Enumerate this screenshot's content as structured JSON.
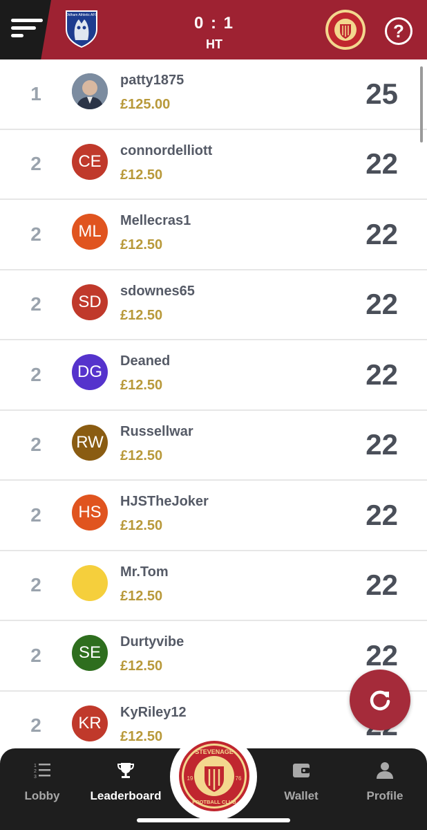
{
  "header": {
    "menu_icon": "menu-icon",
    "home_team_crest": "oldham-athletic-crest",
    "home_crest_text": "Oldham Athletic AFC",
    "score": "0 : 1",
    "period": "HT",
    "away_team_crest": "stevenage-crest",
    "help_label": "?"
  },
  "leaderboard": [
    {
      "rank": "1",
      "initials": "",
      "avatar_color": "#6b7a8a",
      "username": "patty1875",
      "prize": "£125.00",
      "points": "25"
    },
    {
      "rank": "2",
      "initials": "CE",
      "avatar_color": "#c0392b",
      "username": "connordelliott",
      "prize": "£12.50",
      "points": "22"
    },
    {
      "rank": "2",
      "initials": "ML",
      "avatar_color": "#e0541f",
      "username": "Mellecras1",
      "prize": "£12.50",
      "points": "22"
    },
    {
      "rank": "2",
      "initials": "SD",
      "avatar_color": "#c0392b",
      "username": "sdownes65",
      "prize": "£12.50",
      "points": "22"
    },
    {
      "rank": "2",
      "initials": "DG",
      "avatar_color": "#5533cc",
      "username": "Deaned",
      "prize": "£12.50",
      "points": "22"
    },
    {
      "rank": "2",
      "initials": "RW",
      "avatar_color": "#8a5c12",
      "username": "Russellwar",
      "prize": "£12.50",
      "points": "22"
    },
    {
      "rank": "2",
      "initials": "HS",
      "avatar_color": "#e0541f",
      "username": "HJSTheJoker",
      "prize": "£12.50",
      "points": "22"
    },
    {
      "rank": "2",
      "initials": "",
      "avatar_color": "#f5cf3c",
      "username": "Mr.Tom",
      "prize": "£12.50",
      "points": "22"
    },
    {
      "rank": "2",
      "initials": "SE",
      "avatar_color": "#2e6e1e",
      "username": "Durtyvibe",
      "prize": "£12.50",
      "points": "22"
    },
    {
      "rank": "2",
      "initials": "KR",
      "avatar_color": "#c0392b",
      "username": "KyRiley12",
      "prize": "£12.50",
      "points": "22"
    }
  ],
  "refresh_icon": "refresh-icon",
  "nav": {
    "lobby": "Lobby",
    "leaderboard": "Leaderboard",
    "wallet": "Wallet",
    "profile": "Profile",
    "center_crest": "stevenage-crest"
  },
  "crest_text": {
    "top": "STEVENAGE",
    "bottom": "FOOTBALL CLUB",
    "year_left": "19",
    "year_right": "76"
  },
  "colors": {
    "header_bg": "#9e2232",
    "prize_gold": "#b8993a",
    "nav_bg": "#1e1e1e"
  }
}
